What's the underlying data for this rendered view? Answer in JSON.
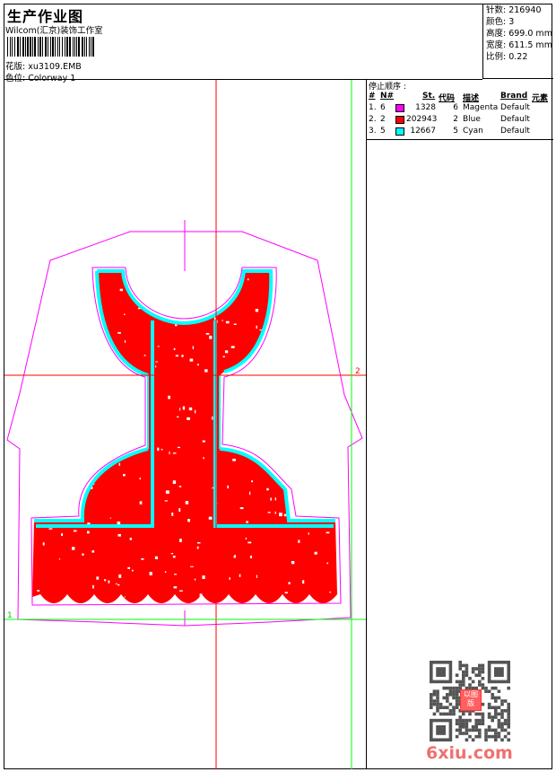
{
  "header": {
    "title": "生产作业图",
    "company": "Wilcom(汇京)装饰工作室",
    "design_label": "花版:",
    "design_value": "xu3109.EMB",
    "colorway_label": "色位:",
    "colorway_value": "Colorway 1"
  },
  "info": {
    "stitches": "针数: 216940",
    "colors": "颜色: 3",
    "height": "高度: 699.0 mm",
    "width": "宽度: 611.5 mm",
    "scale": "比例: 0.22"
  },
  "stop_sequence": {
    "title": "停止顺序 :",
    "columns": [
      "#",
      "N#",
      "St.",
      "代码",
      "描述",
      "Brand",
      "元素"
    ],
    "rows": [
      {
        "idx": "1.",
        "n": "6",
        "color": "#ff00ff",
        "st": "1328",
        "code": "6",
        "desc": "Magenta",
        "brand": "Default"
      },
      {
        "idx": "2.",
        "n": "2",
        "color": "#ff0000",
        "st": "202943",
        "code": "2",
        "desc": "Blue",
        "brand": "Default"
      },
      {
        "idx": "3.",
        "n": "5",
        "color": "#00ffff",
        "st": "12667",
        "code": "5",
        "desc": "Cyan",
        "brand": "Default"
      }
    ]
  },
  "canvas": {
    "marker_1": "1",
    "marker_2": "2",
    "colors": {
      "outline": "#ff00ff",
      "fill": "#ff0000",
      "border": "#00ffff",
      "guide_h": "#ff0000",
      "guide_green": "#00ff00"
    }
  },
  "watermark": {
    "site": "6xiu.com",
    "stamp": "以图版"
  }
}
